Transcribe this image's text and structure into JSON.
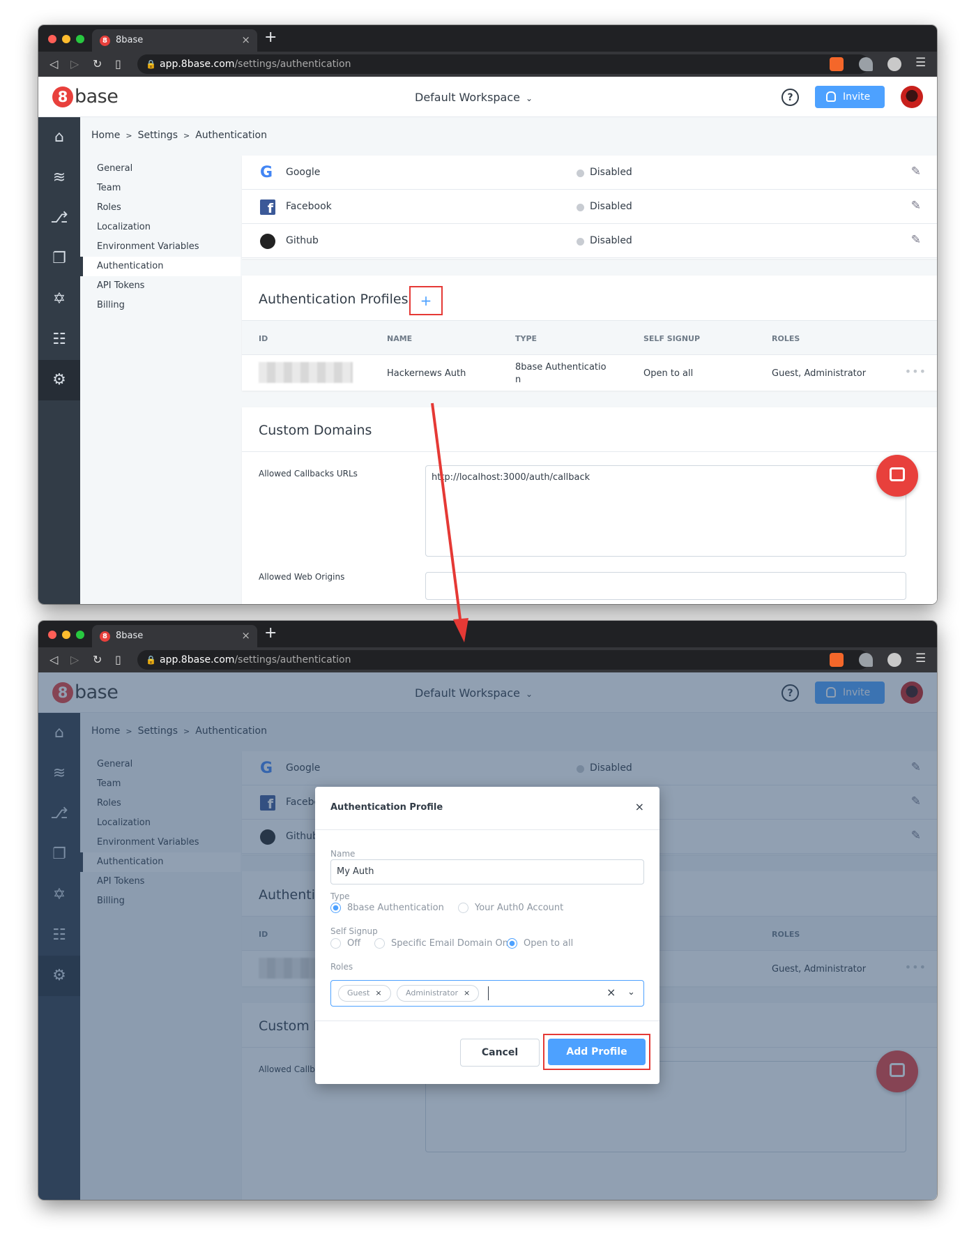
{
  "browser": {
    "tab_title": "8base",
    "favicon": "8",
    "url_host": "app.8base.com",
    "url_path": "/settings/authentication"
  },
  "header": {
    "logo_mark": "8",
    "logo_word": "base",
    "workspace": "Default Workspace",
    "help": "?",
    "invite": "Invite"
  },
  "breadcrumb": {
    "home": "Home",
    "settings": "Settings",
    "current": "Authentication",
    "sep": ">"
  },
  "subnav": [
    "General",
    "Team",
    "Roles",
    "Localization",
    "Environment Variables",
    "Authentication",
    "API Tokens",
    "Billing"
  ],
  "providers": [
    {
      "name": "Google",
      "status": "Disabled"
    },
    {
      "name": "Facebook",
      "status": "Disabled"
    },
    {
      "name": "Github",
      "status": "Disabled"
    }
  ],
  "profiles": {
    "title": "Authentication Profiles",
    "add": "+",
    "columns": [
      "ID",
      "NAME",
      "TYPE",
      "SELF SIGNUP",
      "ROLES"
    ],
    "row": {
      "name": "Hackernews Auth",
      "type": "8base Authenticatio n",
      "self_signup": "Open to all",
      "roles": "Guest, Administrator"
    }
  },
  "domains": {
    "title": "Custom Domains",
    "callback_label": "Allowed Callbacks URLs",
    "callback_value": "http://localhost:3000/auth/callback",
    "web_origins_label": "Allowed Web Origins"
  },
  "dialog": {
    "title": "Authentication Profile",
    "close": "×",
    "name_label": "Name",
    "name_value": "My Auth",
    "type_label": "Type",
    "type_options": [
      "8base Authentication",
      "Your Auth0 Account"
    ],
    "signup_label": "Self Signup",
    "signup_options": [
      "Off",
      "Specific Email Domain Only",
      "Open to all"
    ],
    "roles_label": "Roles",
    "roles": [
      "Guest",
      "Administrator"
    ],
    "cancel": "Cancel",
    "submit": "Add Profile"
  },
  "colors": {
    "brand": "#e8403c",
    "accent": "#4da1ff",
    "highlight": "#e53935",
    "sidebar": "#323c47"
  }
}
